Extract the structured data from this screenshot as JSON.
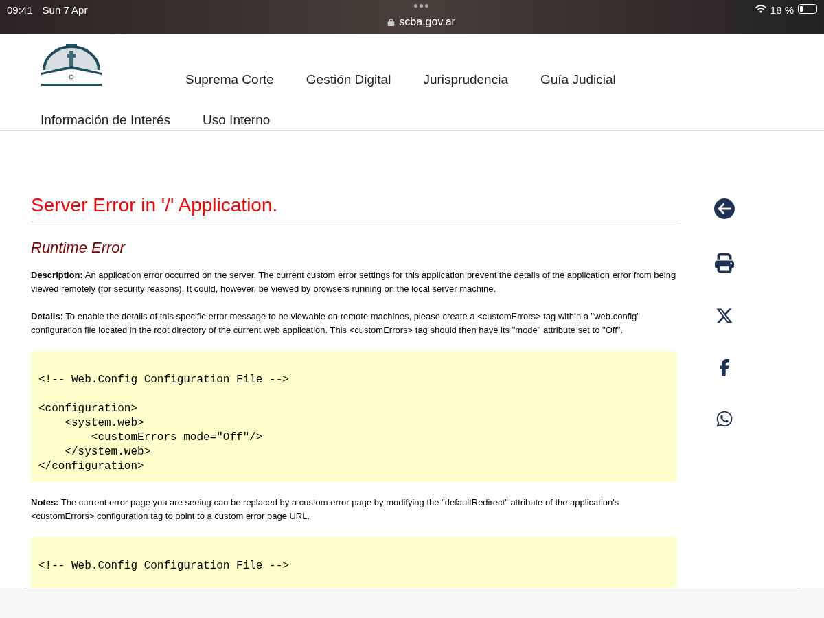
{
  "status_bar": {
    "time": "09:41",
    "date": "Sun 7 Apr",
    "url": "scba.gov.ar",
    "battery": "18 %"
  },
  "nav": {
    "items": [
      "Suprema Corte",
      "Gestión Digital",
      "Jurisprudencia",
      "Guía Judicial",
      "Información de Interés",
      "Uso Interno"
    ]
  },
  "error": {
    "title": "Server Error in '/' Application.",
    "subtitle": "Runtime Error",
    "paragraphs": [
      {
        "label": "Description:",
        "text": "An application error occurred on the server. The current custom error settings for this application prevent the details of the application error from being viewed remotely (for security reasons). It could, however, be viewed by browsers running on the local server machine."
      },
      {
        "label": "Details:",
        "text": "To enable the details of this specific error message to be viewable on remote machines, please create a <customErrors> tag within a \"web.config\" configuration file located in the root directory of the current web application. This <customErrors> tag should then have its \"mode\" attribute set to \"Off\"."
      },
      {
        "label": "Notes:",
        "text": "The current error page you are seeing can be replaced by a custom error page by modifying the \"defaultRedirect\" attribute of the application's <customErrors> configuration tag to point to a custom error page URL."
      }
    ],
    "code_blocks": [
      {
        "groups": [
          [
            "<!-- Web.Config Configuration File -->"
          ],
          [
            "<configuration>",
            "    <system.web>",
            "        <customErrors mode=\"Off\"/>",
            "    </system.web>",
            "</configuration>"
          ]
        ]
      },
      {
        "groups": [
          [
            "<!-- Web.Config Configuration File -->"
          ]
        ]
      }
    ]
  }
}
